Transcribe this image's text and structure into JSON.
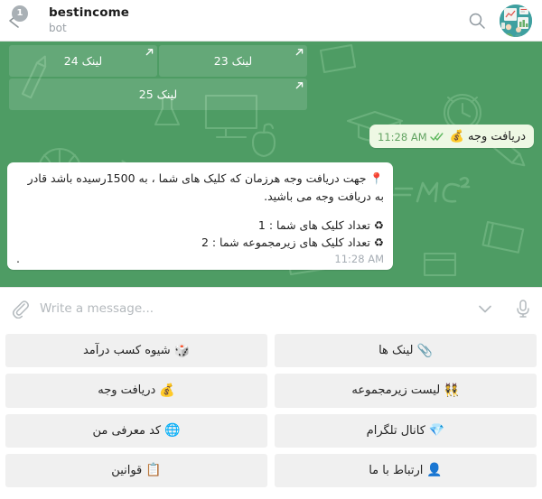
{
  "header": {
    "back_icon": "back-chevron-icon",
    "unread_count": "1",
    "title": "bestincome",
    "status": "bot",
    "search_icon": "search-icon",
    "avatar_icon": "avatar-image"
  },
  "chat": {
    "background_color": "#4e9c64",
    "inline_keyboard": {
      "rows": [
        [
          {
            "label": "لینک 24",
            "external_icon": "external-link-icon"
          },
          {
            "label": "لینک 23",
            "external_icon": "external-link-icon"
          }
        ],
        [
          {
            "label": "لینک 25",
            "external_icon": "external-link-icon"
          }
        ]
      ]
    },
    "messages": [
      {
        "direction": "outgoing",
        "emoji": "💰",
        "text": "دریافت وجه",
        "time": "11:28 AM",
        "status_icon": "double-check-icon",
        "bubble_color": "#eef8e4",
        "time_color": "#62a362"
      },
      {
        "direction": "incoming",
        "paragraph": "📍 جهت دریافت وجه هرزمان که کلیک های شما ، به 1500رسیده باشد قادر به دریافت وجه می باشید.",
        "lines": [
          "♻ تعداد کلیک های شما : 1",
          "♻ تعداد کلیک های زیرمجموعه شما : 2"
        ],
        "trailing_text": ".",
        "time": "11:28 AM",
        "bubble_color": "#ffffff",
        "time_color": "#a6adb4"
      }
    ]
  },
  "composer": {
    "attach_icon": "paperclip-icon",
    "placeholder": "Write a message...",
    "value": "",
    "chevron_icon": "chevron-down-icon",
    "mic_icon": "microphone-icon"
  },
  "reply_keyboard": {
    "rows": [
      [
        {
          "emoji": "🎲",
          "label": "شیوه کسب درآمد"
        },
        {
          "emoji": "📎",
          "label": "لینک ها"
        }
      ],
      [
        {
          "emoji": "💰",
          "label": "دریافت وجه"
        },
        {
          "emoji": "👯",
          "label": "لیست زیرمجموعه"
        }
      ],
      [
        {
          "emoji": "🌐",
          "label": "کد معرفی من"
        },
        {
          "emoji": "💎",
          "label": "کانال تلگرام"
        }
      ],
      [
        {
          "emoji": "📋",
          "label": "قوانین"
        },
        {
          "emoji": "👤",
          "label": "ارتباط با ما"
        }
      ]
    ]
  }
}
